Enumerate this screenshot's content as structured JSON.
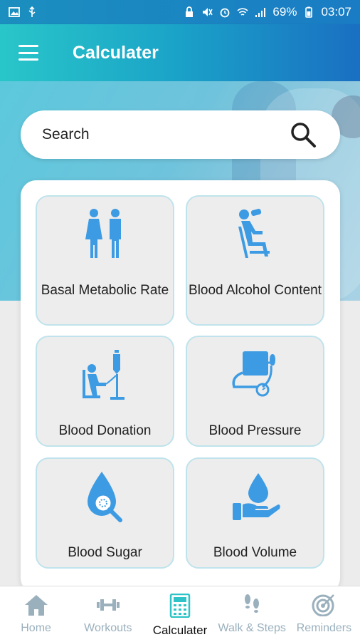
{
  "status_bar": {
    "battery": "69%",
    "time": "03:07"
  },
  "app_bar": {
    "title": "Calculater"
  },
  "search": {
    "placeholder": "Search"
  },
  "tiles": [
    {
      "label": "Basal Metabolic Rate",
      "icon": "couple-icon"
    },
    {
      "label": "Blood Alcohol Content",
      "icon": "person-drinking-icon"
    },
    {
      "label": "Blood Donation",
      "icon": "blood-donation-icon"
    },
    {
      "label": "Blood Pressure",
      "icon": "blood-pressure-monitor-icon"
    },
    {
      "label": "Blood Sugar",
      "icon": "blood-drop-magnifier-icon"
    },
    {
      "label": "Blood Volume",
      "icon": "drop-on-hand-icon"
    }
  ],
  "bottom_nav": [
    {
      "label": "Home",
      "icon": "home-icon"
    },
    {
      "label": "Workouts",
      "icon": "dumbbell-icon"
    },
    {
      "label": "Calculater",
      "icon": "calculator-icon",
      "active": true
    },
    {
      "label": "Walk & Steps",
      "icon": "footsteps-icon"
    },
    {
      "label": "Reminders",
      "icon": "target-icon"
    }
  ],
  "colors": {
    "icon_blue": "#3d9be3",
    "accent_teal": "#2ec4c7",
    "nav_inactive": "#9ab0bd"
  }
}
